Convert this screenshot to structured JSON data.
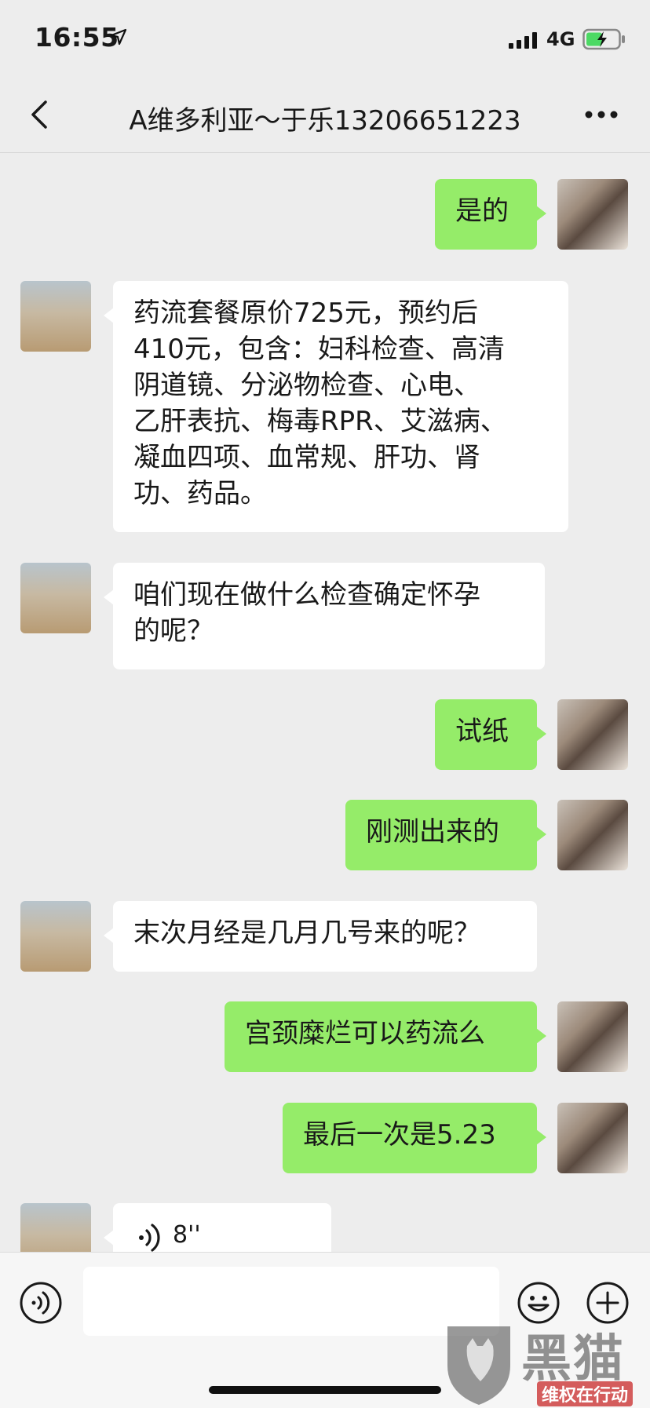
{
  "status_bar": {
    "time": "16:55",
    "network": "4G",
    "icons": [
      "location-arrow-icon",
      "signal-icon",
      "battery-charging-icon"
    ]
  },
  "header": {
    "title": "A维多利亚～于乐13206651223",
    "back_icon": "chevron-left-icon",
    "more_icon": "more-dots-icon"
  },
  "messages": [
    {
      "side": "out",
      "lines": [
        "是的"
      ]
    },
    {
      "side": "in",
      "lines": [
        "药流套餐原价725元，预约后",
        "410元，包含：妇科检查、高清",
        "阴道镜、分泌物检查、心电、",
        "乙肝表抗、梅毒RPR、艾滋病、",
        "凝血四项、血常规、肝功、肾",
        "功、药品。"
      ]
    },
    {
      "side": "in",
      "lines": [
        "咱们现在做什么检查确定怀孕",
        "的呢？"
      ]
    },
    {
      "side": "out",
      "lines": [
        "试纸"
      ]
    },
    {
      "side": "out",
      "lines": [
        "刚测出来的"
      ]
    },
    {
      "side": "in",
      "lines": [
        "末次月经是几月几号来的呢？"
      ]
    },
    {
      "side": "out",
      "lines": [
        "宫颈糜烂可以药流么"
      ]
    },
    {
      "side": "out",
      "lines": [
        "最后一次是5.23"
      ]
    },
    {
      "side": "in",
      "type": "voice",
      "duration": "8''"
    }
  ],
  "input_bar": {
    "voice_icon": "voice-input-icon",
    "emoji_icon": "emoji-icon",
    "plus_icon": "plus-icon",
    "input_value": ""
  },
  "watermark": {
    "text": "黑猫",
    "subtext": "维权在行动"
  },
  "colors": {
    "background": "#ededed",
    "outgoing_bubble": "#95ec69",
    "incoming_bubble": "#ffffff"
  }
}
